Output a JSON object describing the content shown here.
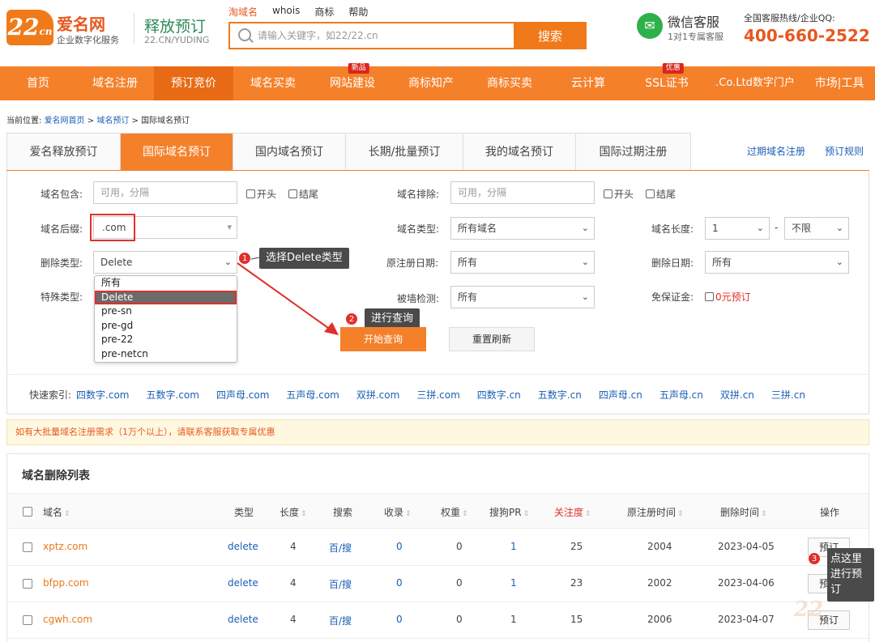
{
  "brand": {
    "logo_badge": "22",
    "logo_badge_small": "cn",
    "name": "爱名网",
    "slogan": "企业数字化服务",
    "page_title": "释放预订",
    "page_sub": "22.CN/YUDING"
  },
  "top_links": [
    "淘域名",
    "whois",
    "商标",
    "帮助"
  ],
  "search": {
    "placeholder": "请输入关键字，如22/22.cn",
    "button": "搜索"
  },
  "wechat": {
    "title": "微信客服",
    "sub": "1对1专属客服"
  },
  "hotline": {
    "label": "全国客服热线/企业QQ:",
    "number": "400-660-2522"
  },
  "nav": [
    {
      "label": "首页"
    },
    {
      "label": "域名注册"
    },
    {
      "label": "预订竞价",
      "active": true
    },
    {
      "label": "域名买卖"
    },
    {
      "label": "网站建设",
      "badge": "新品"
    },
    {
      "label": "商标知产"
    },
    {
      "label": "商标买卖"
    },
    {
      "label": "云计算"
    },
    {
      "label": "SSL证书",
      "badge": "优惠"
    },
    {
      "label": ".Co.Ltd数字门户"
    },
    {
      "label": "市场|工具"
    }
  ],
  "breadcrumb": {
    "prefix": "当前位置:",
    "home": "爱名网首页",
    "sep": ">",
    "level2": "域名预订",
    "current": "国际域名预订"
  },
  "tabs": [
    "爱名释放预订",
    "国际域名预订",
    "国内域名预订",
    "长期/批量预订",
    "我的域名预订",
    "国际过期注册"
  ],
  "side_links": [
    "过期域名注册",
    "预订规则"
  ],
  "form": {
    "contains_label": "域名包含:",
    "contains_placeholder": "可用，分隔",
    "exclude_label": "域名排除:",
    "exclude_placeholder": "可用，分隔",
    "cb_start": "开头",
    "cb_end": "结尾",
    "suffix_label": "域名后缀:",
    "suffix_value": ".com",
    "dtype_label": "域名类型:",
    "dtype_value": "所有域名",
    "length_label": "域名长度:",
    "length_min": "1",
    "length_dash": "-",
    "length_max": "不限",
    "del_type_label": "删除类型:",
    "del_type_value": "Delete",
    "reg_date_label": "原注册日期:",
    "reg_date_value": "所有",
    "del_date_label": "删除日期:",
    "del_date_value": "所有",
    "special_label": "特殊类型:",
    "wall_label": "被墙检测:",
    "wall_value": "所有",
    "deposit_label": "免保证金:",
    "deposit_value": "0元预订",
    "query_btn": "开始查询",
    "reset_btn": "重置刷新"
  },
  "dropdown_options": [
    "所有",
    "Delete",
    "pre-sn",
    "pre-gd",
    "pre-22",
    "pre-netcn"
  ],
  "callouts": {
    "step1_num": "1",
    "step1": "选择Delete类型",
    "step2_num": "2",
    "step2": "进行查询",
    "step3_num": "3",
    "step3": "点这里进行预订"
  },
  "quick": {
    "label": "快速索引:",
    "items": [
      "四数字.com",
      "五数字.com",
      "四声母.com",
      "五声母.com",
      "双拼.com",
      "三拼.com",
      "四数字.cn",
      "五数字.cn",
      "四声母.cn",
      "五声母.cn",
      "双拼.cn",
      "三拼.cn"
    ]
  },
  "notice": "如有大批量域名注册需求（1万个以上），请联系客服获取专属优惠",
  "list": {
    "title": "域名删除列表",
    "headers": [
      "域名",
      "类型",
      "长度",
      "搜索",
      "收录",
      "权重",
      "搜狗PR",
      "关注度",
      "原注册时间",
      "删除时间",
      "操作"
    ],
    "rows": [
      {
        "domain": "xptz.com",
        "type": "delete",
        "length": "4",
        "search": "百/搜",
        "indexed": "0",
        "weight": "0",
        "pr": "1",
        "attention": "25",
        "reg": "2004",
        "del": "2023-04-05",
        "action": "预订"
      },
      {
        "domain": "bfpp.com",
        "type": "delete",
        "length": "4",
        "search": "百/搜",
        "indexed": "0",
        "weight": "0",
        "pr": "1",
        "attention": "23",
        "reg": "2002",
        "del": "2023-04-06",
        "action": "预订"
      },
      {
        "domain": "cgwh.com",
        "type": "delete",
        "length": "4",
        "search": "百/搜",
        "indexed": "0",
        "weight": "0",
        "pr": "1",
        "attention": "15",
        "reg": "2006",
        "del": "2023-04-07",
        "action": "预订"
      }
    ]
  },
  "colors": {
    "accent": "#f5802a",
    "brand_red": "#e8571f",
    "link": "#1a5fb4",
    "annotation_red": "#e0302a"
  }
}
